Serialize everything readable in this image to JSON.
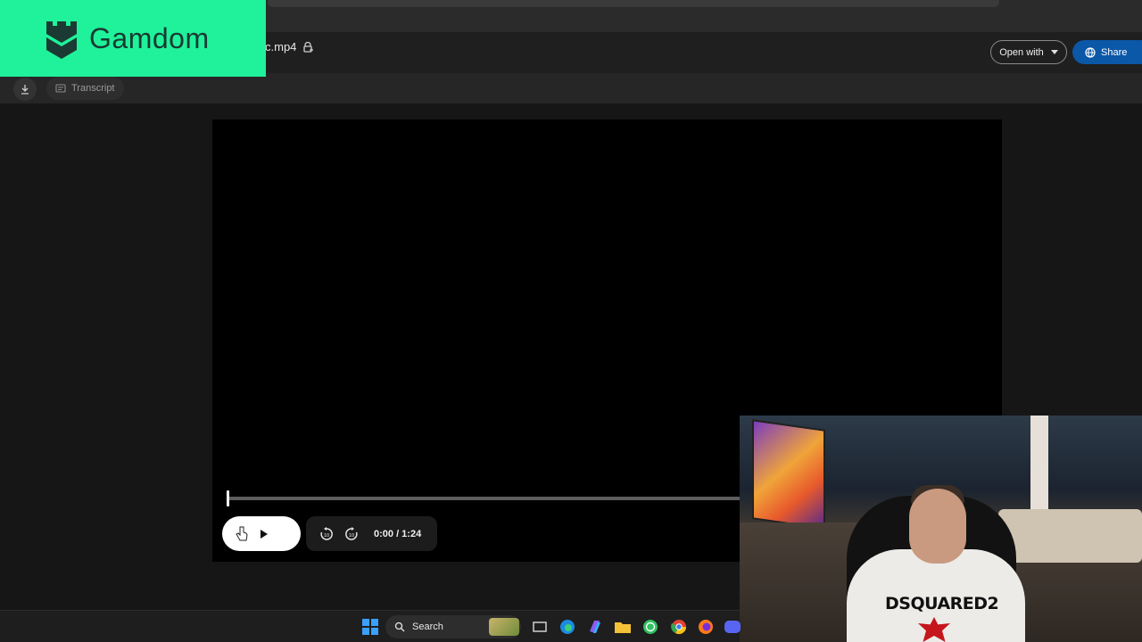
{
  "brand": {
    "name": "Gamdom",
    "color": "#1ff29a",
    "icon": "castle-tower-icon"
  },
  "header": {
    "file_name": "c.mp4",
    "open_with_label": "Open with",
    "share_label": "Share"
  },
  "toolbar": {
    "transcript_label": "Transcript",
    "download_icon": "download-icon"
  },
  "player": {
    "time": "0:00 / 1:24",
    "progress": 0
  },
  "webcam": {
    "shirt_print": "DSQUARED2"
  },
  "taskbar": {
    "search_label": "Search"
  },
  "colors": {
    "share_bg": "#0b57a8",
    "background": "#161616",
    "video_bg": "#000000"
  }
}
